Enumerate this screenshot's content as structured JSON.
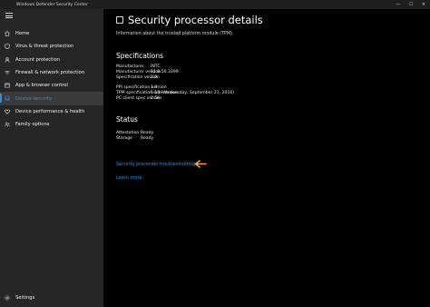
{
  "window": {
    "title": "Windows Defender Security Center",
    "controls": {
      "minimize": "—",
      "maximize": "☐",
      "close": "✕"
    }
  },
  "sidebar": {
    "items": [
      {
        "label": "Home",
        "icon": "home-icon"
      },
      {
        "label": "Virus & threat protection",
        "icon": "shield-icon"
      },
      {
        "label": "Account protection",
        "icon": "person-icon"
      },
      {
        "label": "Firewall & network protection",
        "icon": "wifi-icon"
      },
      {
        "label": "App & browser control",
        "icon": "app-window-icon"
      },
      {
        "label": "Device security",
        "icon": "laptop-icon",
        "selected": true
      },
      {
        "label": "Device performance & health",
        "icon": "heart-icon"
      },
      {
        "label": "Family options",
        "icon": "family-icon"
      }
    ],
    "settings_label": "Settings"
  },
  "main": {
    "title": "Security processor details",
    "subtitle": "Information about the trusted platform module (TPM).",
    "specifications": {
      "heading": "Specifications",
      "group1": [
        {
          "key": "Manufacturer",
          "value": "INTC"
        },
        {
          "key": "Manufacturer version",
          "value": "11.8.50.3399"
        },
        {
          "key": "Specification version",
          "value": "2.0"
        }
      ],
      "group2": [
        {
          "key": "PPI specification version",
          "value": "1.3"
        },
        {
          "key": "TPM specification sub-version",
          "value": "1.16 (Wednesday, September 21, 2016)"
        },
        {
          "key": "PC client spec version",
          "value": "2.56"
        }
      ]
    },
    "status": {
      "heading": "Status",
      "rows": [
        {
          "key": "Attestation",
          "value": "Ready"
        },
        {
          "key": "Storage",
          "value": "Ready"
        }
      ]
    },
    "links": {
      "troubleshooting": "Security processor troubleshooting",
      "learn_more": "Learn more"
    }
  },
  "colors": {
    "accent": "#2f8fe0",
    "sidebar_bg": "#262626",
    "content_bg": "#000000",
    "annotation_arrow": "#f2a33a"
  }
}
